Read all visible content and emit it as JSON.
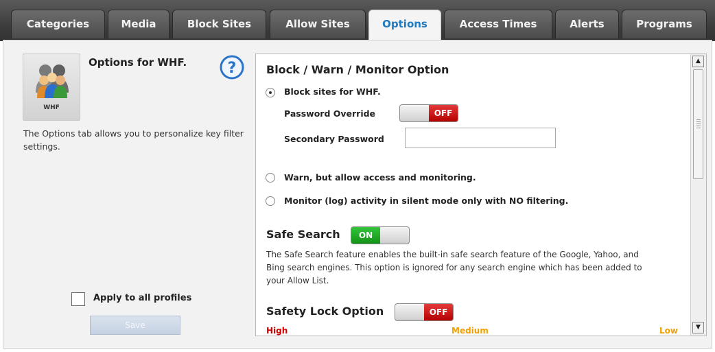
{
  "tabs": [
    {
      "label": "Categories",
      "active": false
    },
    {
      "label": "Media",
      "active": false
    },
    {
      "label": "Block Sites",
      "active": false
    },
    {
      "label": "Allow Sites",
      "active": false
    },
    {
      "label": "Options",
      "active": true
    },
    {
      "label": "Access Times",
      "active": false
    },
    {
      "label": "Alerts",
      "active": false
    },
    {
      "label": "Programs",
      "active": false
    }
  ],
  "profile": {
    "avatar_label": "WHF",
    "title": "Options for WHF.",
    "description": "The Options tab allows you to personalize key filter settings.",
    "help_icon": "question-mark-icon"
  },
  "footer": {
    "apply_label": "Apply to all profiles",
    "apply_checked": false,
    "save_label": "Save"
  },
  "panel": {
    "title": "Block / Warn / Monitor Option",
    "options": {
      "block": {
        "label": "Block sites for WHF.",
        "checked": true
      },
      "warn": {
        "label": "Warn, but allow access and monitoring.",
        "checked": false
      },
      "monitor": {
        "label": "Monitor (log) activity in silent mode only with NO filtering.",
        "checked": false
      }
    },
    "password_override": {
      "label": "Password Override",
      "state": "OFF"
    },
    "secondary_password": {
      "label": "Secondary Password",
      "value": ""
    },
    "safe_search": {
      "title": "Safe Search",
      "state": "ON",
      "description": "The Safe Search feature enables the built-in safe search feature of the Google, Yahoo, and Bing search engines.  This option is ignored for any search engine which has been added to your Allow List."
    },
    "safety_lock": {
      "title": "Safety Lock Option",
      "state": "OFF",
      "levels": {
        "high": "High",
        "medium": "Medium",
        "low": "Low"
      }
    }
  },
  "colors": {
    "active_tab_text": "#1f7ac0",
    "toggle_off": "#c80000",
    "toggle_on": "#1fa825",
    "level_high": "#d40000",
    "level_medium": "#f0a000",
    "level_low": "#f0a000"
  }
}
